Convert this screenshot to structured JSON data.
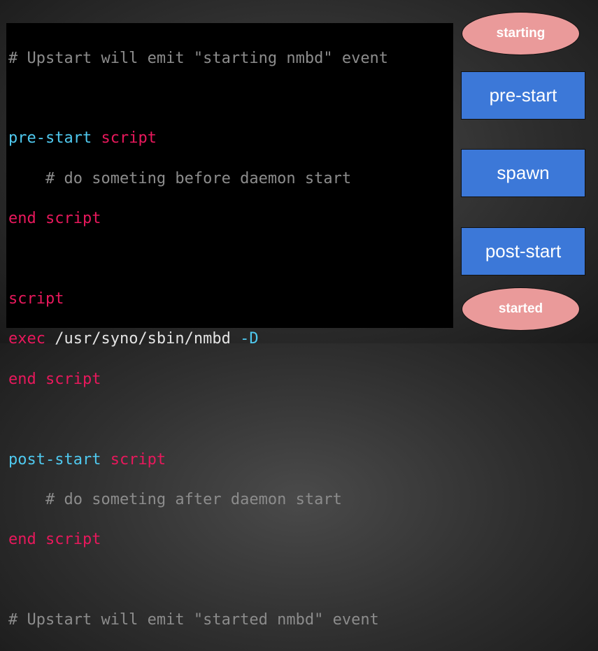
{
  "code": {
    "line1_comment": "# Upstart will emit \"starting nmbd\" event",
    "line3_a": "pre-start",
    "line3_b": "script",
    "line4_comment": "    # do someting before daemon start",
    "line5_a": "end",
    "line5_b": "script",
    "line7_a": "script",
    "line8_a": "exec",
    "line8_b": "/usr/syno/sbin/nmbd",
    "line8_c": "-D",
    "line9_a": "end",
    "line9_b": "script",
    "line11_a": "post-start",
    "line11_b": "script",
    "line12_comment": "    # do someting after daemon start",
    "line13_a": "end",
    "line13_b": "script",
    "line15_comment": "# Upstart will emit \"started nmbd\" event"
  },
  "flow": {
    "starting": "starting",
    "pre_start": "pre-start",
    "spawn": "spawn",
    "post_start": "post-start",
    "started": "started"
  },
  "colors": {
    "comment": "#8c8c8c",
    "keyword": "#e8185c",
    "cyan": "#4fc9ef",
    "event_ellipse": "#ea9a9a",
    "stage_box": "#3c78d8"
  }
}
